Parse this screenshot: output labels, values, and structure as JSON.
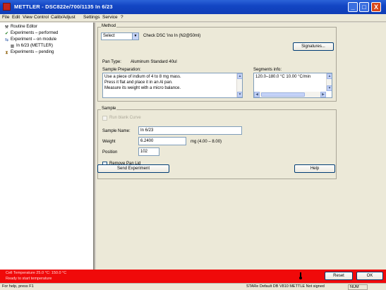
{
  "window": {
    "title": "METTLER - DSC822e/700/1135 In 6/23",
    "controls": {
      "minimize": "_",
      "maximize": "□",
      "close": "X"
    }
  },
  "menu": [
    "File",
    "Edit",
    "View",
    "Control",
    "Calib/Adjust",
    "Settings",
    "Service",
    "?"
  ],
  "tree": [
    {
      "icon": "wrench-icon",
      "glyph": "⚒",
      "label": "Routine Editor"
    },
    {
      "icon": "check-icon",
      "glyph": "✔",
      "label": "Experiments – performed"
    },
    {
      "icon": "arrows-icon",
      "glyph": "⇆",
      "label": "Experiment – on module"
    },
    {
      "icon": "sample-icon",
      "glyph": "▦",
      "label": "In 6/23 (METTLER)"
    },
    {
      "icon": "hourglass-icon",
      "glyph": "⧗",
      "label": "Experiments – pending"
    }
  ],
  "method": {
    "group_label": "Method",
    "select_value": "Select",
    "check_text": "Check DSC 'ino In (N2@50ml)",
    "signatures_button": "Signatures...",
    "pan_type_label": "Pan Type:",
    "pan_type_value": "Aluminum Standard 40ul",
    "sample_prep_label": "Sample Preparation:",
    "sample_prep_lines": [
      "Use a piece of indium of 4 to 8 mg mass.",
      "Press it flat and place it in an Al pan.",
      "Measure its weight with a micro balance."
    ],
    "segments_label": "Segments info:",
    "segments_line": "120.0–180.0 °C 10.00 °C/min"
  },
  "sample": {
    "group_label": "Sample",
    "run_blank_label": "Run blank Curve",
    "name_label": "Sample Name:",
    "name_value": "In 6/23",
    "weight_label": "Weight",
    "weight_value": "6.2400",
    "weight_unit": "mg (4.00 – 8.00)",
    "position_label": "Position",
    "position_value": "102",
    "remove_lid_label": "Remove Pan Lid"
  },
  "actions": {
    "send_experiment": "Send Experiment",
    "help": "Help"
  },
  "alarm": {
    "line1": "Cell Temperature 25.0 °C: 150.0 °C",
    "line2": "Ready to start temperature",
    "reset_button": "Reset",
    "ok_button": "OK"
  },
  "status": {
    "help_text": "For help, press F1",
    "db_text": "STARe Default DB V810 METTLE Not signed",
    "num": "NUM"
  },
  "colors": {
    "titlebar": "#1346c4",
    "alarm": "#f00a0a",
    "panel": "#ece9d8"
  }
}
